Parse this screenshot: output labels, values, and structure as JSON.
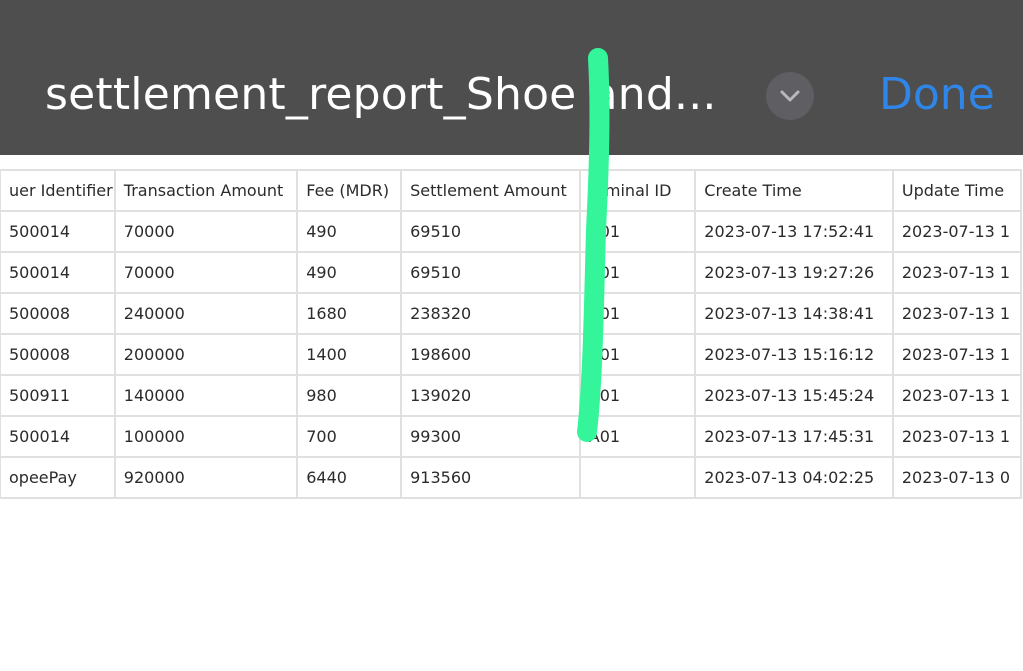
{
  "header": {
    "title": "settlement_report_Shoe and...",
    "chevron_icon": "chevron-down-icon",
    "done_label": "Done",
    "accent_color": "#2f86e8"
  },
  "table": {
    "columns": [
      "uer Identifier",
      "Transaction Amount",
      "Fee (MDR)",
      "Settlement Amount",
      "erminal ID",
      "Create Time",
      "Update Time"
    ],
    "rows": [
      [
        "500014",
        "70000",
        "490",
        "69510",
        "A01",
        "2023-07-13 17:52:41",
        "2023-07-13 1"
      ],
      [
        "500014",
        "70000",
        "490",
        "69510",
        "A01",
        "2023-07-13 19:27:26",
        "2023-07-13 1"
      ],
      [
        "500008",
        "240000",
        "1680",
        "238320",
        "A01",
        "2023-07-13 14:38:41",
        "2023-07-13 1"
      ],
      [
        "500008",
        "200000",
        "1400",
        "198600",
        "A01",
        "2023-07-13 15:16:12",
        "2023-07-13 1"
      ],
      [
        "500911",
        "140000",
        "980",
        "139020",
        "A01",
        "2023-07-13 15:45:24",
        "2023-07-13 1"
      ],
      [
        "500014",
        "100000",
        "700",
        "99300",
        "A01",
        "2023-07-13 17:45:31",
        "2023-07-13 1"
      ],
      [
        "opeePay",
        "920000",
        "6440",
        "913560",
        "",
        "2023-07-13 04:02:25",
        "2023-07-13 0"
      ]
    ]
  },
  "annotation": {
    "marker_color": "#34f59a"
  }
}
